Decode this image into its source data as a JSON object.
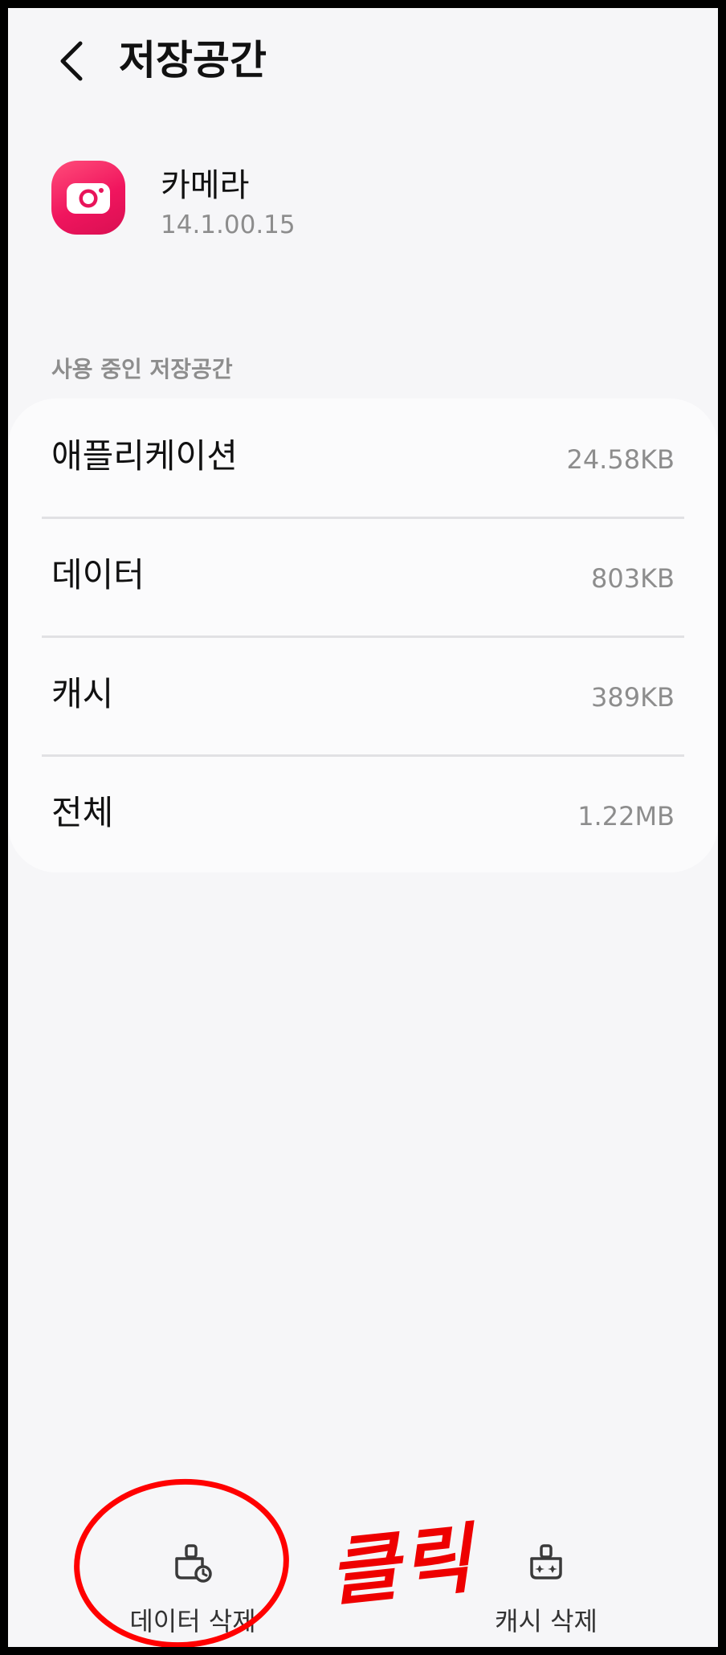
{
  "header": {
    "title": "저장공간",
    "back_icon": "chevron-left-icon"
  },
  "app": {
    "name": "카메라",
    "version": "14.1.00.15",
    "icon": "camera-app-icon",
    "icon_color": "#f0155e"
  },
  "storage": {
    "section_label": "사용 중인 저장공간",
    "rows": [
      {
        "label": "애플리케이션",
        "value": "24.58KB"
      },
      {
        "label": "데이터",
        "value": "803KB"
      },
      {
        "label": "캐시",
        "value": "389KB"
      },
      {
        "label": "전체",
        "value": "1.22MB"
      }
    ]
  },
  "actions": {
    "clear_data": {
      "label": "데이터 삭제",
      "icon": "clear-data-icon"
    },
    "clear_cache": {
      "label": "캐시 삭제",
      "icon": "clear-cache-icon"
    }
  },
  "annotation": {
    "text": "클릭",
    "color": "#ee0000"
  }
}
